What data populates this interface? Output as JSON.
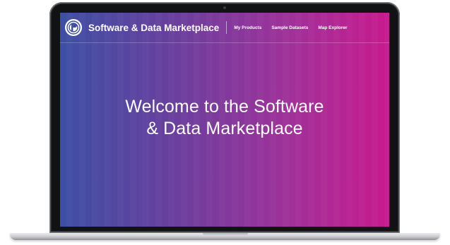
{
  "header": {
    "brand": "Software & Data Marketplace",
    "nav": [
      {
        "label": "My Products"
      },
      {
        "label": "Sample Datasets"
      },
      {
        "label": "Map Explorer"
      }
    ]
  },
  "hero": {
    "line1": "Welcome to the Software",
    "line2": "& Data Marketplace"
  },
  "icons": {
    "logo": "brand-logo-icon"
  },
  "colors": {
    "gradient_start": "#3d4fa4",
    "gradient_mid": "#6a3f9e",
    "gradient_end": "#c81a8d",
    "text": "#ffffff"
  }
}
